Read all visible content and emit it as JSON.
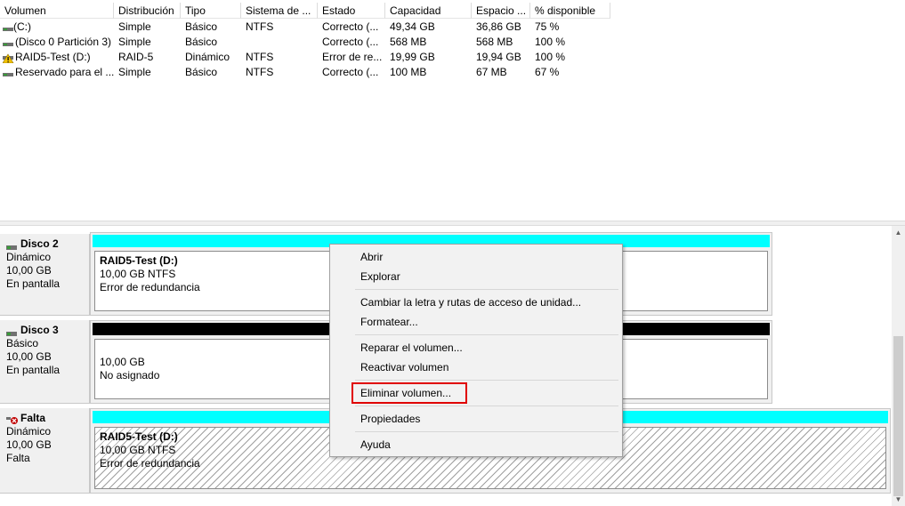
{
  "volume_list": {
    "columns": [
      "Volumen",
      "Distribución",
      "Tipo",
      "Sistema de ...",
      "Estado",
      "Capacidad",
      "Espacio ...",
      "% disponible"
    ],
    "rows": [
      {
        "icon": "volume-icon",
        "volume": " (C:)",
        "layout": "Simple",
        "type": "Básico",
        "fs": "NTFS",
        "status": "Correcto (...",
        "capacity": "49,34 GB",
        "free": "36,86 GB",
        "pct": "75 %"
      },
      {
        "icon": "volume-icon",
        "volume": "(Disco 0 Partición 3)",
        "layout": "Simple",
        "type": "Básico",
        "fs": "",
        "status": "Correcto (...",
        "capacity": "568 MB",
        "free": "568 MB",
        "pct": "100 %"
      },
      {
        "icon": "volume-warning-icon",
        "volume": "RAID5-Test (D:)",
        "layout": "RAID-5",
        "type": "Dinámico",
        "fs": "NTFS",
        "status": "Error de re...",
        "capacity": "19,99 GB",
        "free": "19,94 GB",
        "pct": "100 %"
      },
      {
        "icon": "volume-icon",
        "volume": "Reservado para el ...",
        "layout": "Simple",
        "type": "Básico",
        "fs": "NTFS",
        "status": "Correcto (...",
        "capacity": "100 MB",
        "free": "67 MB",
        "pct": "67 %"
      }
    ]
  },
  "disks": [
    {
      "name": "Disco 2",
      "type": "Dinámico",
      "size": "10,00 GB",
      "state": "En pantalla",
      "icon": "disk-icon",
      "partition": {
        "title": "RAID5-Test  (D:)",
        "line2": "10,00 GB NTFS",
        "line3": "Error de redundancia",
        "bar_color": "#00ffff"
      }
    },
    {
      "name": "Disco 3",
      "type": "Básico",
      "size": "10,00 GB",
      "state": "En pantalla",
      "icon": "disk-icon",
      "partition": {
        "title": "",
        "line2": "10,00 GB",
        "line3": "No asignado",
        "bar_color": "#000000"
      }
    },
    {
      "name": "Falta",
      "type": "Dinámico",
      "size": "10,00 GB",
      "state": "Falta",
      "icon": "disk-missing-icon",
      "partition": {
        "title": "RAID5-Test  (D:)",
        "line2": "10,00 GB NTFS",
        "line3": "Error de redundancia",
        "bar_color": "#00ffff"
      }
    }
  ],
  "context_menu": {
    "items": [
      "Abrir",
      "Explorar",
      "Cambiar la letra y rutas de acceso de unidad...",
      "Formatear...",
      "Reparar el volumen...",
      "Reactivar volumen",
      "Eliminar volumen...",
      "Propiedades",
      "Ayuda"
    ],
    "highlighted": "Eliminar volumen...",
    "highlight_color": "#e00000"
  }
}
